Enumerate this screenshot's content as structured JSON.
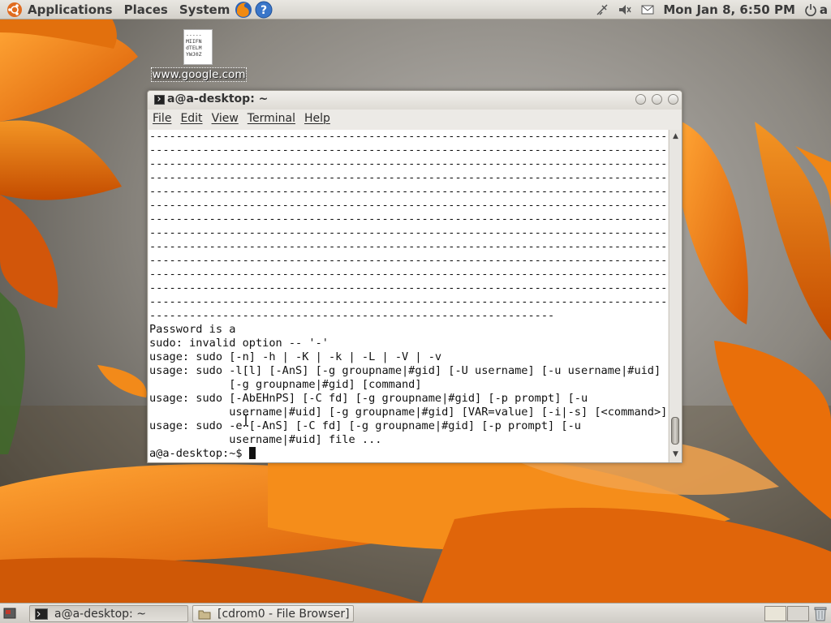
{
  "top_panel": {
    "menus": [
      "Applications",
      "Places",
      "System"
    ],
    "clock": "Mon Jan  8,  6:50 PM",
    "session_user": "a",
    "icons": [
      "ubuntu-logo-icon",
      "firefox-icon",
      "help-icon",
      "network-icon",
      "volume-icon",
      "mail-icon",
      "power-icon"
    ]
  },
  "desktop": {
    "file_label": "www.google.com",
    "file_thumb_text": "-----\nMIIFN\ndTELM\nYWJ0Z"
  },
  "terminal": {
    "title": "a@a-desktop: ~",
    "menus": [
      "File",
      "Edit",
      "View",
      "Terminal",
      "Help"
    ],
    "lines": [
      "-----------------------------------------------------------------------------------",
      "-----------------------------------------------------------------------------------",
      "-----------------------------------------------------------------------------------",
      "-----------------------------------------------------------------------------------",
      "-----------------------------------------------------------------------------------",
      "-----------------------------------------------------------------------------------",
      "-----------------------------------------------------------------------------------",
      "-----------------------------------------------------------------------------------",
      "-----------------------------------------------------------------------------------",
      "-----------------------------------------------------------------------------------",
      "-----------------------------------------------------------------------------------",
      "-----------------------------------------------------------------------------------",
      "-----------------------------------------------------------------------------------",
      "-------------------------------------------------------------",
      "Password is a",
      "sudo: invalid option -- '-'",
      "usage: sudo [-n] -h | -K | -k | -L | -V | -v",
      "usage: sudo -l[l] [-AnS] [-g groupname|#gid] [-U username] [-u username|#uid]",
      "            [-g groupname|#gid] [command]",
      "usage: sudo [-AbEHnPS] [-C fd] [-g groupname|#gid] [-p prompt] [-u",
      "            username|#uid] [-g groupname|#gid] [VAR=value] [-i|-s] [<command>]",
      "usage: sudo -e [-AnS] [-C fd] [-g groupname|#gid] [-p prompt] [-u",
      "            username|#uid] file ..."
    ],
    "prompt": "a@a-desktop:~$ "
  },
  "bottom_panel": {
    "tasks": [
      "a@a-desktop: ~",
      "[cdrom0 - File Browser]"
    ],
    "icons": [
      "show-desktop-icon",
      "terminal-icon",
      "folder-icon",
      "trash-icon"
    ]
  },
  "colors": {
    "panel": "#dcd9d3",
    "terminal_bg": "#ffffff",
    "wallpaper_orange": "#f07a10"
  }
}
